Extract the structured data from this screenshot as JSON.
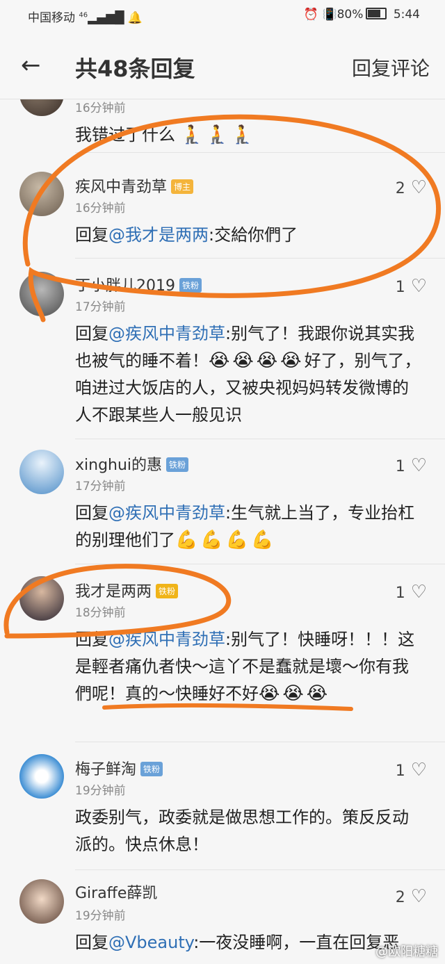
{
  "status": {
    "carrier": "中国移动",
    "signal": "46",
    "battery": "80%",
    "time": "5:44"
  },
  "header": {
    "back_icon": "arrow-left-icon",
    "title": "共48条回复",
    "reply_label": "回复评论"
  },
  "comments": [
    {
      "user": "",
      "badge": "",
      "time": "16分钟前",
      "likes": "",
      "text": "我错过了什么",
      "emoji": [
        "🧎",
        "🧎",
        "🧎"
      ]
    },
    {
      "user": "疾风中青劲草",
      "badge": "博主",
      "time": "16分钟前",
      "likes": "2",
      "text_prefix": "回复",
      "mention": "@我才是两两",
      "text": ":交給你們了"
    },
    {
      "user": "丁小胖儿2019",
      "badge": "铁粉",
      "time": "17分钟前",
      "likes": "1",
      "text_prefix": "回复",
      "mention": "@疾风中青劲草",
      "text_a": ":别气了！我跟你说其实我也被气的睡不着！",
      "emoji": [
        "😭",
        "😭",
        "😭",
        "😭"
      ],
      "text_b": "好了，别气了，咱进过大饭店的人，又被央视妈妈转发微博的人不跟某些人一般见识"
    },
    {
      "user": "xinghui的惠",
      "badge": "铁粉",
      "time": "17分钟前",
      "likes": "1",
      "text_prefix": "回复",
      "mention": "@疾风中青劲草",
      "text": ":生气就上当了，专业抬杠的别理他们了",
      "emoji": [
        "💪",
        "💪",
        "💪",
        "💪"
      ]
    },
    {
      "user": "我才是两两",
      "badge": "铁粉",
      "time": "18分钟前",
      "likes": "1",
      "text_prefix": "回复",
      "mention": "@疾风中青劲草",
      "text": ":别气了！快睡呀！！！这是輕者痛仇者快～這丫不是蠢就是壞～你有我們呢！真的～快睡好不好",
      "emoji": [
        "😭",
        "😭",
        "😭"
      ]
    },
    {
      "user": "梅子鲜淘",
      "badge": "铁粉",
      "time": "19分钟前",
      "likes": "1",
      "text": "政委别气，政委就是做思想工作的。策反反动派的。快点休息！"
    },
    {
      "user": "Giraffe薛凯",
      "badge": "",
      "time": "19分钟前",
      "likes": "2",
      "text_prefix": "回复",
      "mention": "@Vbeauty",
      "text": ":一夜没睡啊，一直在回复恶"
    }
  ],
  "watermark": "@欧阳糖糖",
  "colors": {
    "mention": "#2f6fb5",
    "annotation": "#f07a22"
  }
}
